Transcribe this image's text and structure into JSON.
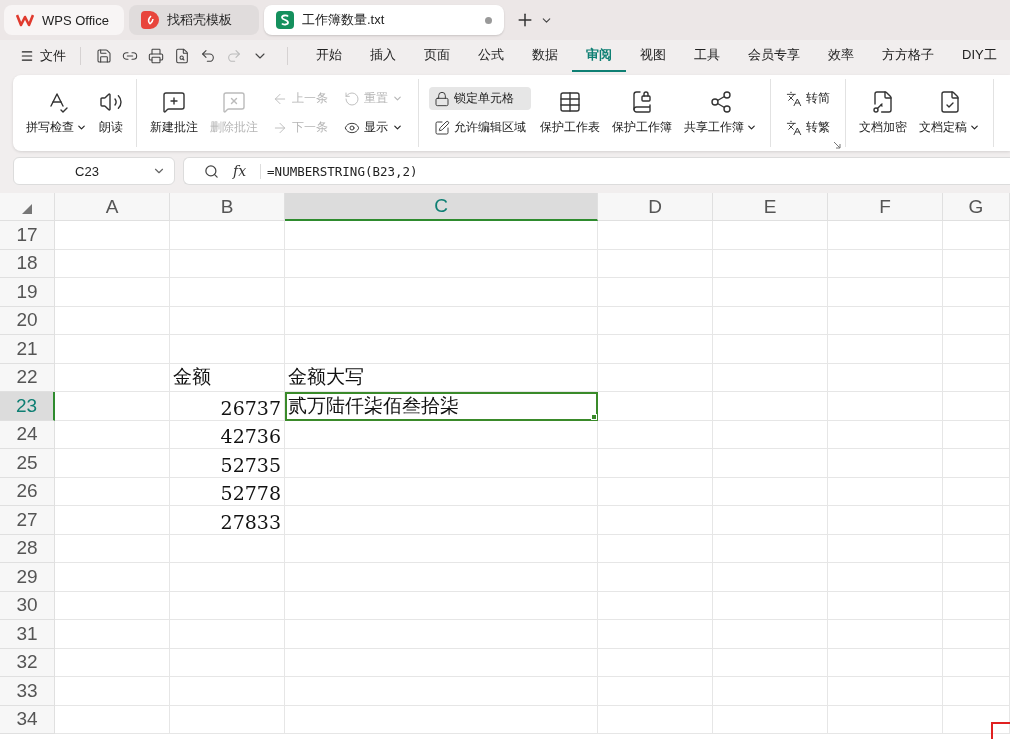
{
  "tabs": [
    {
      "label": "WPS Office",
      "kind": "home",
      "selected": false,
      "modified": false
    },
    {
      "label": "找稻壳模板",
      "kind": "docer",
      "selected": false,
      "modified": false
    },
    {
      "label": "工作簿数量.txt",
      "kind": "sheet",
      "selected": true,
      "modified": true
    }
  ],
  "file_menu": "文件",
  "menu_tabs": [
    {
      "label": "开始",
      "selected": false
    },
    {
      "label": "插入",
      "selected": false
    },
    {
      "label": "页面",
      "selected": false
    },
    {
      "label": "公式",
      "selected": false
    },
    {
      "label": "数据",
      "selected": false
    },
    {
      "label": "审阅",
      "selected": true
    },
    {
      "label": "视图",
      "selected": false
    },
    {
      "label": "工具",
      "selected": false
    },
    {
      "label": "会员专享",
      "selected": false
    },
    {
      "label": "效率",
      "selected": false
    },
    {
      "label": "方方格子",
      "selected": false
    },
    {
      "label": "DIY工",
      "selected": false
    }
  ],
  "ribbon": {
    "groups": [
      {
        "launcher": false,
        "items": [
          {
            "kind": "large",
            "label": "拼写检查",
            "disabled": false,
            "dropdown": true,
            "highlighted": false
          },
          {
            "kind": "large",
            "label": "朗读",
            "disabled": false,
            "dropdown": false,
            "highlighted": false
          }
        ]
      },
      {
        "launcher": false,
        "items": [
          {
            "kind": "large",
            "label": "新建批注",
            "disabled": false,
            "dropdown": false,
            "highlighted": false
          },
          {
            "kind": "large",
            "label": "删除批注",
            "disabled": true,
            "dropdown": false,
            "highlighted": false
          },
          {
            "kind": "stack",
            "items": [
              {
                "label": "上一条",
                "disabled": true,
                "dropdown": false,
                "highlighted": false
              },
              {
                "label": "下一条",
                "disabled": true,
                "dropdown": false,
                "highlighted": false
              }
            ]
          },
          {
            "kind": "stack",
            "items": [
              {
                "label": "重置",
                "disabled": true,
                "dropdown": true,
                "highlighted": false
              },
              {
                "label": "显示",
                "disabled": false,
                "dropdown": true,
                "highlighted": false
              }
            ]
          }
        ]
      },
      {
        "launcher": false,
        "items": [
          {
            "kind": "stack",
            "items": [
              {
                "label": "锁定单元格",
                "disabled": false,
                "dropdown": false,
                "highlighted": true
              },
              {
                "label": "允许编辑区域",
                "disabled": false,
                "dropdown": false,
                "highlighted": false
              }
            ]
          },
          {
            "kind": "large",
            "label": "保护工作表",
            "disabled": false,
            "dropdown": false,
            "highlighted": false
          },
          {
            "kind": "large",
            "label": "保护工作簿",
            "disabled": false,
            "dropdown": false,
            "highlighted": false
          },
          {
            "kind": "large",
            "label": "共享工作簿",
            "disabled": false,
            "dropdown": true,
            "highlighted": false
          }
        ]
      },
      {
        "launcher": true,
        "items": [
          {
            "kind": "stack",
            "items": [
              {
                "label": "转简",
                "disabled": false,
                "dropdown": false,
                "highlighted": false
              },
              {
                "label": "转繁",
                "disabled": false,
                "dropdown": false,
                "highlighted": false
              }
            ]
          }
        ]
      },
      {
        "launcher": false,
        "items": [
          {
            "kind": "large",
            "label": "文档加密",
            "disabled": false,
            "dropdown": false,
            "highlighted": false
          },
          {
            "kind": "large",
            "label": "文档定稿",
            "disabled": false,
            "dropdown": true,
            "highlighted": false
          }
        ]
      }
    ]
  },
  "name_box": "C23",
  "function_button": "fx",
  "formula": "=NUMBERSTRING(B23,2)",
  "grid": {
    "columns": [
      {
        "label": "A",
        "selected": false
      },
      {
        "label": "B",
        "selected": false
      },
      {
        "label": "C",
        "selected": true
      },
      {
        "label": "D",
        "selected": false
      },
      {
        "label": "E",
        "selected": false
      },
      {
        "label": "F",
        "selected": false
      },
      {
        "label": "G",
        "selected": false
      }
    ],
    "rows": [
      {
        "label": "17",
        "selected": false
      },
      {
        "label": "18",
        "selected": false
      },
      {
        "label": "19",
        "selected": false
      },
      {
        "label": "20",
        "selected": false
      },
      {
        "label": "21",
        "selected": false
      },
      {
        "label": "22",
        "selected": false,
        "b": "金额",
        "c": "金额大写"
      },
      {
        "label": "23",
        "selected": true,
        "b": "26737",
        "c": "贰万陆仟柒佰叁拾柒"
      },
      {
        "label": "24",
        "selected": false,
        "b": "42736"
      },
      {
        "label": "25",
        "selected": false,
        "b": "52735"
      },
      {
        "label": "26",
        "selected": false,
        "b": "52778"
      },
      {
        "label": "27",
        "selected": false,
        "b": "27833"
      },
      {
        "label": "28",
        "selected": false
      },
      {
        "label": "29",
        "selected": false
      },
      {
        "label": "30",
        "selected": false
      },
      {
        "label": "31",
        "selected": false
      },
      {
        "label": "32",
        "selected": false
      },
      {
        "label": "33",
        "selected": false
      },
      {
        "label": "34",
        "selected": false
      }
    ]
  }
}
